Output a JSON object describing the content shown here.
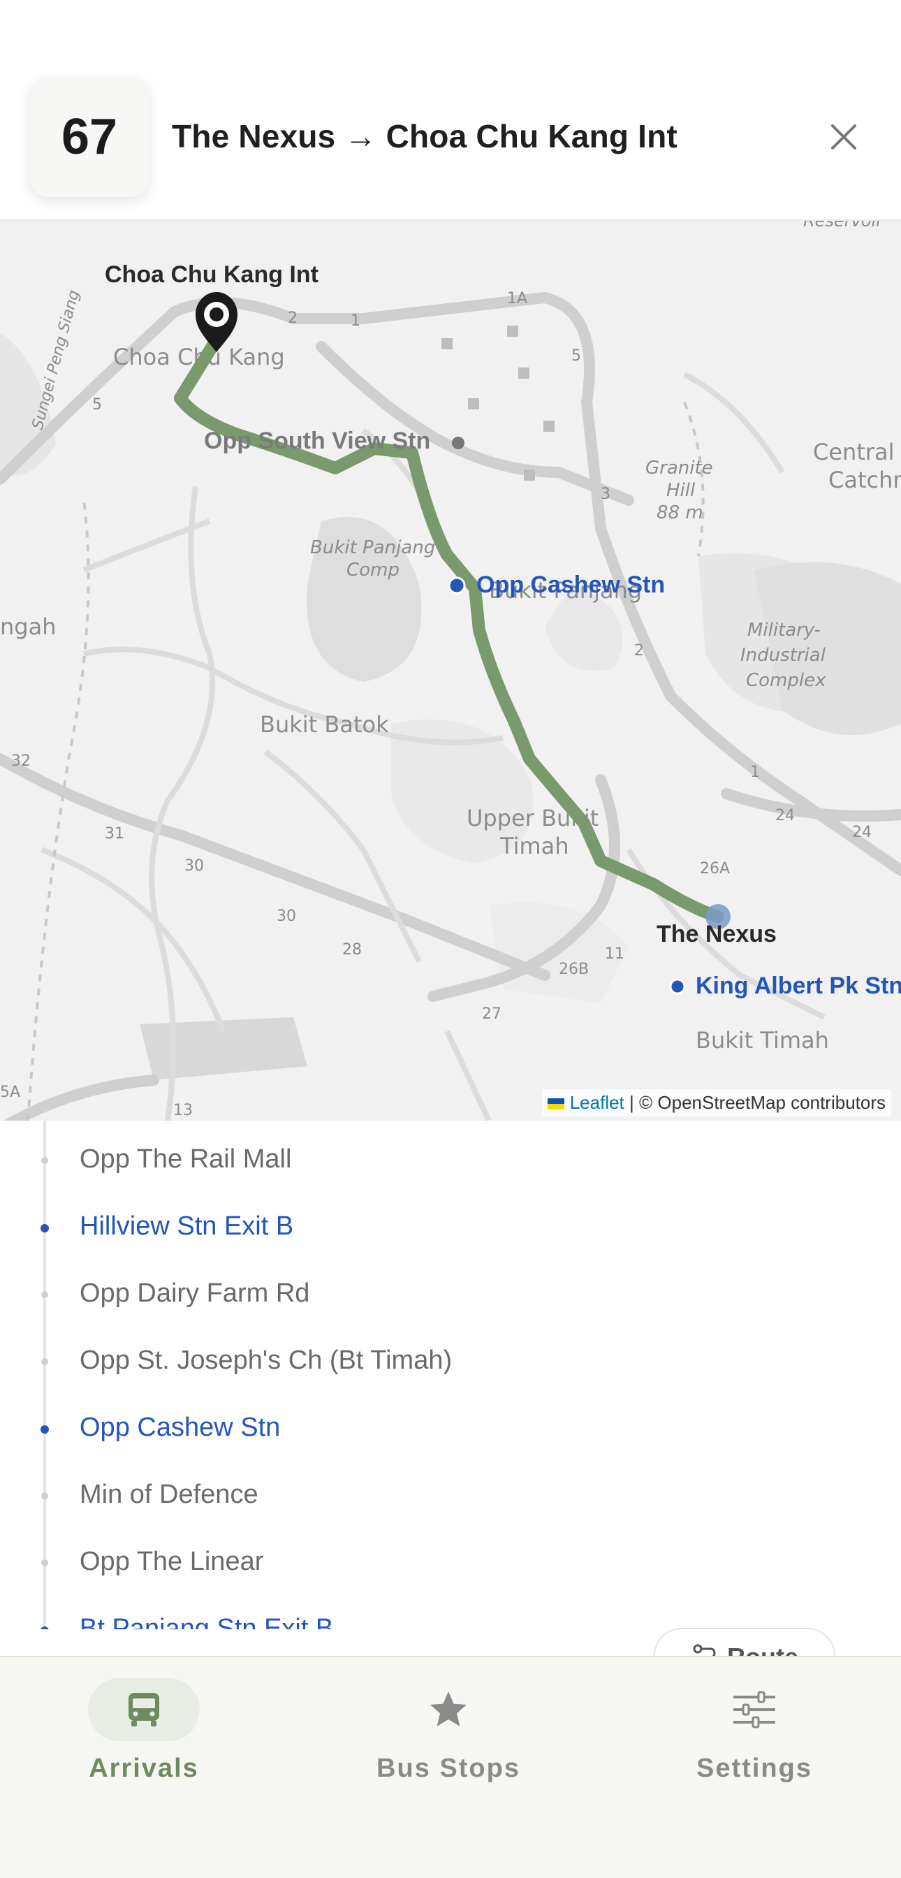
{
  "header": {
    "route_number": "67",
    "title": "The Nexus → Choa Chu Kang Int"
  },
  "map": {
    "attribution_leaflet": "Leaflet",
    "attribution_rest": " | © OpenStreetMap contributors",
    "route_color": "#7a9a6d",
    "stop_color": "#2455b8",
    "labels": {
      "terminus_start": "Choa Chu Kang Int",
      "terminus_end": "The Nexus",
      "stop_grey": "Opp South View Stn",
      "stop_blue_1": "Opp Cashew Stn",
      "stop_blue_2": "King Albert Pk Stn"
    },
    "base_labels": {
      "choa_chu_kang": "Choa Chu Kang",
      "bukit_panjang_comp_1": "Bukit Panjang",
      "bukit_panjang_comp_2": "Comp",
      "bukit_panjang": "Bukit Panjang",
      "bukit_batok": "Bukit Batok",
      "upper_bukit_timah_1": "Upper Bukit",
      "upper_bukit_timah_2": "Timah",
      "bukit_timah": "Bukit Timah",
      "granite_hill_1": "Granite",
      "granite_hill_2": "Hill",
      "granite_hill_3": "88 m",
      "central_catchment_1": "Central",
      "central_catchment_2": "Catchm",
      "military_1": "Military-",
      "military_2": "Industrial",
      "military_3": "Complex",
      "reservoir": "Reservoir",
      "ngah": "ngah",
      "sungei": "Sungei Peng Siang",
      "road_1a": "1A",
      "road_2": "2",
      "road_3": "3",
      "road_5": "5",
      "road_1": "1",
      "road_24": "24",
      "road_26a": "26A",
      "road_26b": "26B",
      "road_27": "27",
      "road_28": "28",
      "road_30": "30",
      "road_31": "31",
      "road_32": "32",
      "road_13": "13",
      "road_5a": "5A",
      "road_11": "11"
    }
  },
  "stops": [
    {
      "name": "Opp The Rail Mall",
      "highlight": false
    },
    {
      "name": "Hillview Stn Exit B",
      "highlight": true
    },
    {
      "name": "Opp Dairy Farm Rd",
      "highlight": false
    },
    {
      "name": "Opp St. Joseph's Ch (Bt Timah)",
      "highlight": false
    },
    {
      "name": "Opp Cashew Stn",
      "highlight": true
    },
    {
      "name": "Min of Defence",
      "highlight": false
    },
    {
      "name": "Opp The Linear",
      "highlight": false
    },
    {
      "name": "Bt Panjang Stn Exit B",
      "highlight": true
    }
  ],
  "route_button": {
    "label": "Route"
  },
  "nav": {
    "arrivals": "Arrivals",
    "bus_stops": "Bus Stops",
    "settings": "Settings",
    "active_color": "#6f8a61",
    "inactive_color": "#8a8a8a"
  }
}
